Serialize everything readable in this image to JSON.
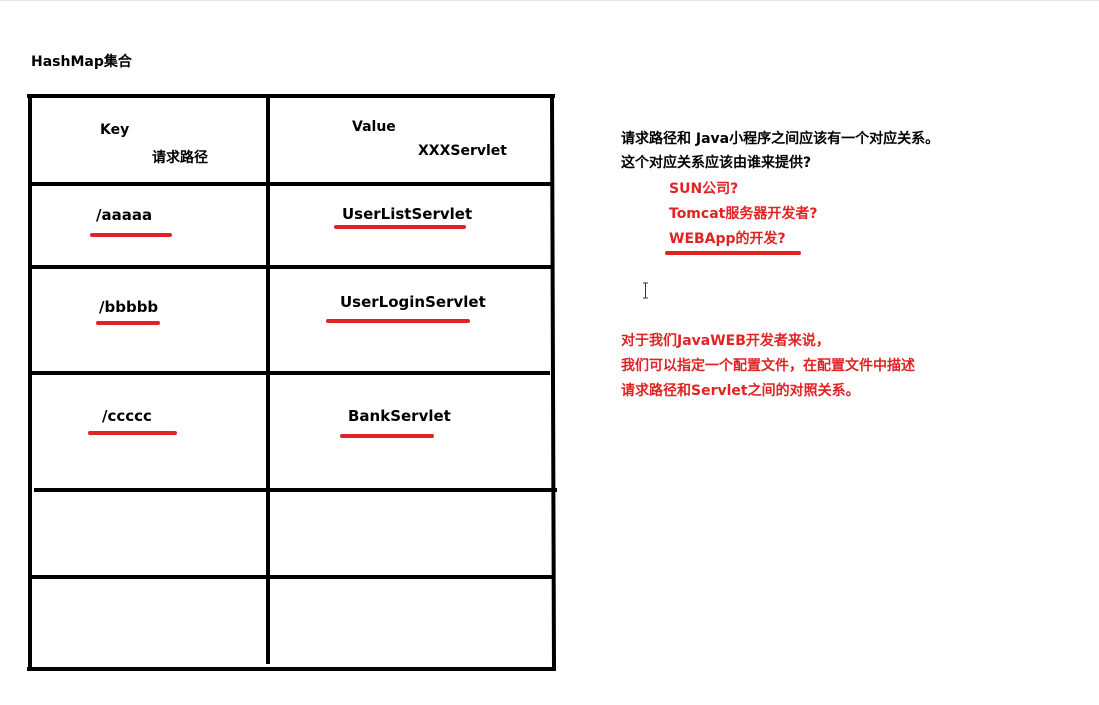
{
  "title": "HashMap集合",
  "table": {
    "header": {
      "key_label": "Key",
      "key_sub": "请求路径",
      "value_label": "Value",
      "value_sub": "XXXServlet"
    },
    "rows": [
      {
        "key": "/aaaaa",
        "value": "UserListServlet"
      },
      {
        "key": "/bbbbb",
        "value": "UserLoginServlet"
      },
      {
        "key": "/ccccc",
        "value": "BankServlet"
      }
    ]
  },
  "notes": {
    "question_line1": "请求路径和     Java小程序之间应该有一个对应关系。",
    "question_line2": "这个对应关系应该由谁来提供?",
    "options": [
      "SUN公司?",
      "Tomcat服务器开发者?",
      "WEBApp的开发?"
    ],
    "answer_lines": [
      "对于我们JavaWEB开发者来说，",
      "我们可以指定一个配置文件，在配置文件中描述",
      "请求路径和Servlet之间的对照关系。"
    ]
  },
  "colors": {
    "ink": "#000000",
    "highlight": "#e02323"
  },
  "icons": {
    "cursor": "text-cursor-icon"
  }
}
